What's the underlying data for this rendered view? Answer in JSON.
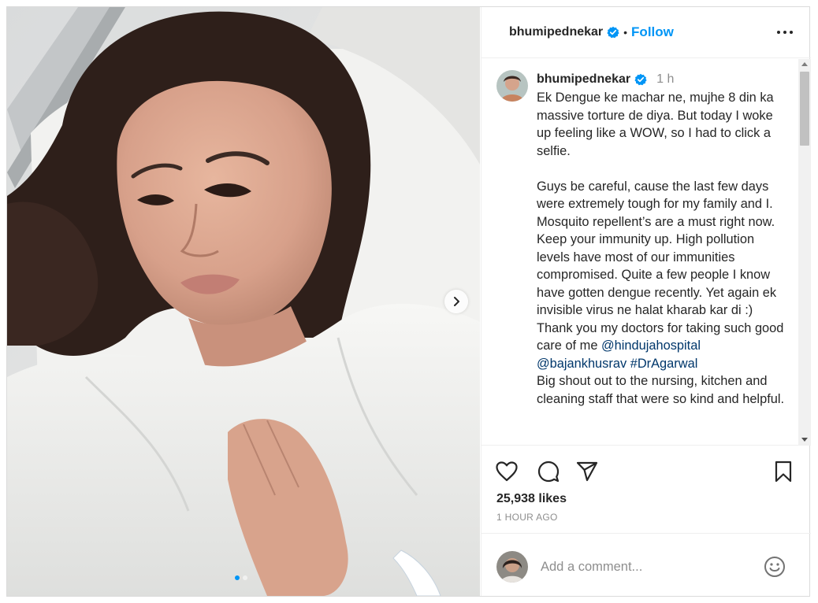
{
  "post": {
    "username": "bhumipednekar",
    "verified_icon": "verified-badge-icon",
    "separator": "•",
    "follow_label": "Follow",
    "more_icon": "more-options-icon"
  },
  "caption": {
    "username": "bhumipednekar",
    "time": "1 h",
    "paragraph_1": "Ek Dengue ke machar ne, mujhe 8 din ka massive torture de diya. But today I woke up feeling like a WOW, so I had to click a selfie.",
    "paragraph_2": "Guys be careful, cause the last few days were extremely tough for my family and I. Mosquito repellent’s are a must right now. Keep your immunity up. High pollution levels have most of our immunities compromised. Quite a few people I know have gotten dengue recently. Yet again ek invisible virus ne halat kharab kar di :)",
    "paragraph_3": "Thank you my doctors for taking such good care of me ",
    "mention_1": "@hindujahospital",
    "mention_2": "@bajankhusrav",
    "hashtag_1": "#DrAgarwal",
    "paragraph_4": "Big shout out to the nursing, kitchen and cleaning staff that were so kind and helpful."
  },
  "carousel": {
    "slide_count": 2,
    "active_slide": 1,
    "next_icon": "chevron-right-icon"
  },
  "actions": {
    "icons": [
      "heart-icon",
      "comment-icon",
      "share-icon",
      "bookmark-icon"
    ],
    "likes": "25,938 likes",
    "posted": "1 HOUR AGO"
  },
  "comment_box": {
    "placeholder": "Add a comment...",
    "emoji_icon": "emoji-icon"
  },
  "colors": {
    "accent": "#0095f6",
    "link": "#00376b",
    "muted": "#8e8e8e",
    "text": "#262626",
    "border": "#dbdbdb"
  }
}
